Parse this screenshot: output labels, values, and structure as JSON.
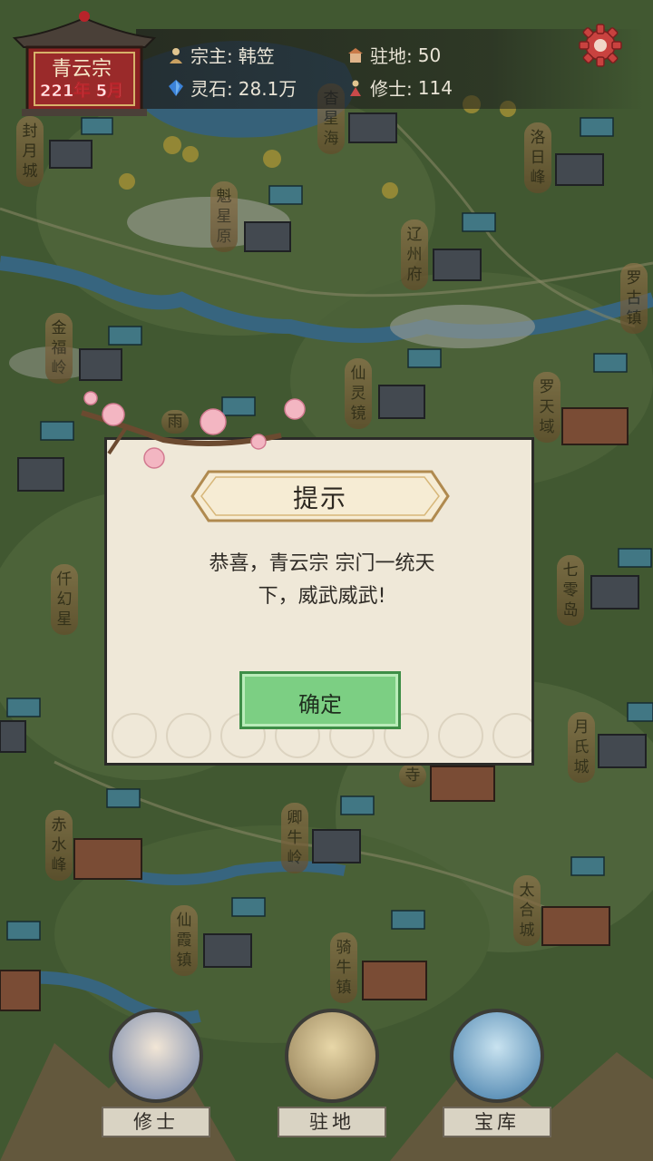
{
  "header": {
    "sect_name": "青云宗",
    "date": "221年 5月",
    "leader_label": "宗主:",
    "leader_name": "韩笠",
    "spirit_stone_label": "灵石:",
    "spirit_stone_value": "28.1万",
    "territory_label": "驻地:",
    "territory_value": "50",
    "cultivator_label": "修士:",
    "cultivator_value": "114"
  },
  "map": {
    "places": [
      "封月城",
      "杳星海",
      "洛日峰",
      "魁星原",
      "辽州府",
      "罗古镇",
      "金福岭",
      "仙灵镜",
      "罗天域",
      "仟幻星",
      "七零岛",
      "月氏城",
      "赤水峰",
      "卿牛岭",
      "太合城",
      "仙霞镇",
      "骑牛镇",
      "雨",
      "寺"
    ],
    "flag_glyph": "云"
  },
  "dialog": {
    "title": "提示",
    "message_line1": "恭喜，青云宗 宗门一统天",
    "message_line2": "下，威武威武!",
    "confirm_label": "确定"
  },
  "nav": [
    {
      "label": "修士"
    },
    {
      "label": "驻地"
    },
    {
      "label": "宝库"
    }
  ]
}
